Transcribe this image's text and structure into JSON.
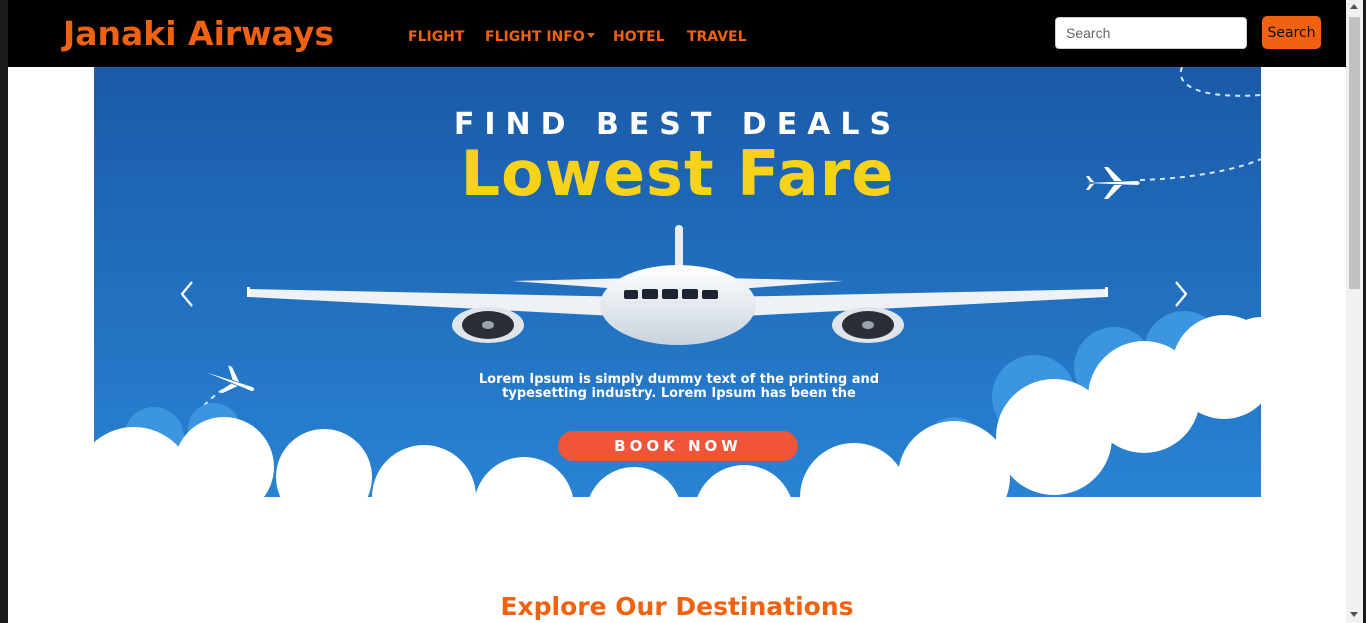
{
  "navbar": {
    "brand": "Janaki Airways",
    "links": [
      "FLIGHT",
      "FLIGHT INFO",
      "HOTEL",
      "TRAVEL"
    ],
    "search_placeholder": "Search",
    "search_button": "Search"
  },
  "banner": {
    "headline_top": "FIND BEST DEALS",
    "headline_main": "Lowest Fare",
    "lorem_line1": "Lorem Ipsum is simply dummy text of the printing and",
    "lorem_line2": "typesetting industry. Lorem Ipsum has been the",
    "cta": "BOOK NOW"
  },
  "section": {
    "title": "Explore Our Destinations"
  },
  "colors": {
    "accent": "#f0620f",
    "navbar_bg": "#000000",
    "banner_sky": "#1f6fbf",
    "headline_yellow": "#f7d21b",
    "cta": "#f0553a"
  },
  "icons": [
    "chevron-left-icon",
    "chevron-right-icon",
    "airplane-icon",
    "caret-down-icon"
  ]
}
